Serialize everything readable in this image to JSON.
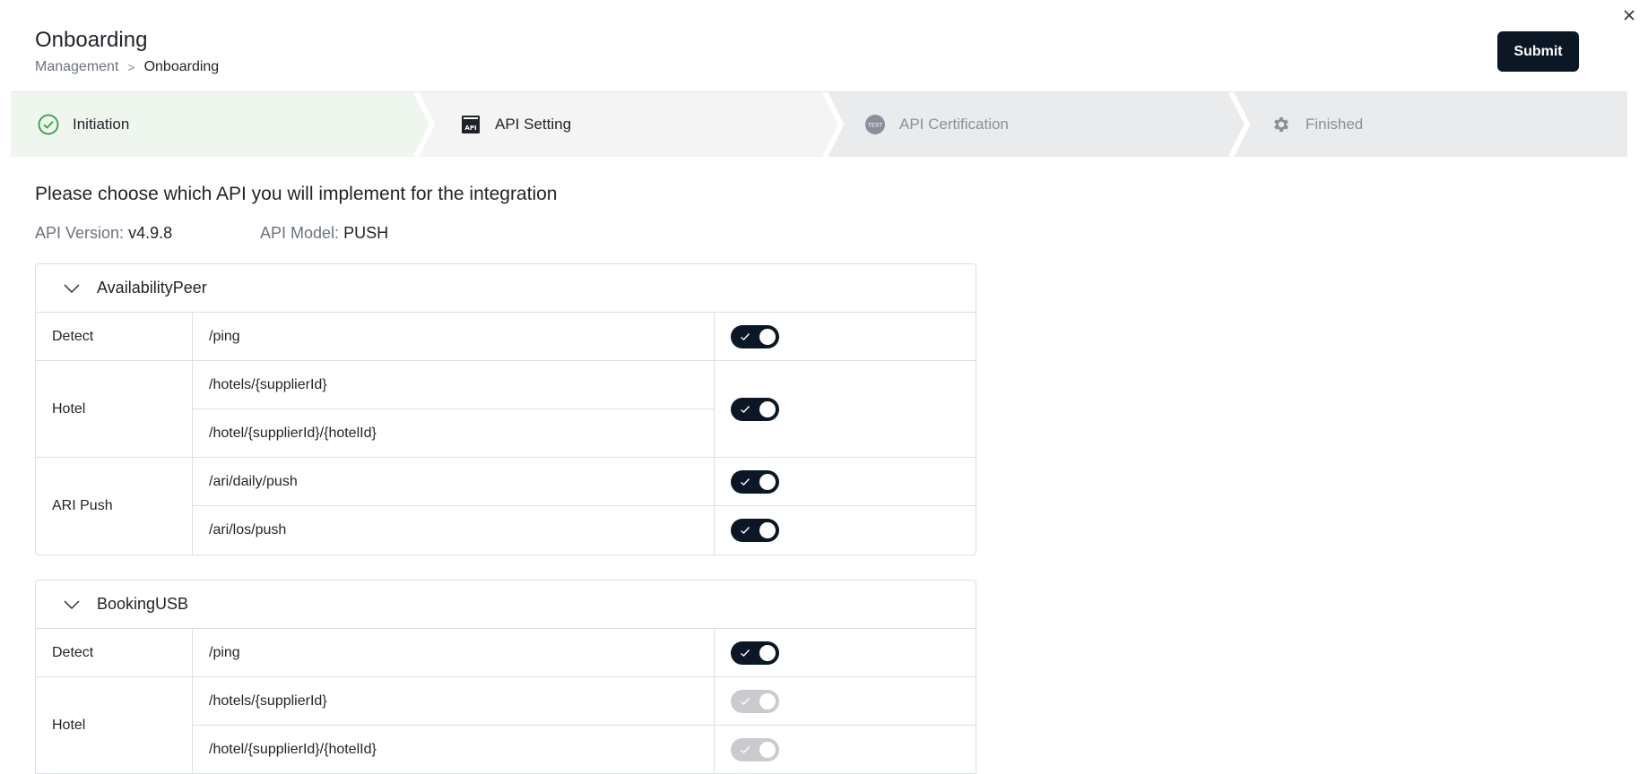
{
  "header": {
    "title": "Onboarding",
    "breadcrumb": {
      "parent": "Management",
      "separator": ">",
      "current": "Onboarding"
    },
    "submit_label": "Submit"
  },
  "steps": [
    {
      "label": "Initiation",
      "state": "done",
      "icon": "check-circle-icon"
    },
    {
      "label": "API Setting",
      "state": "active",
      "icon": "api-icon"
    },
    {
      "label": "API Certification",
      "state": "pending",
      "icon": "test-icon"
    },
    {
      "label": "Finished",
      "state": "pending",
      "icon": "gear-icon"
    }
  ],
  "question": "Please choose which API you will implement for the integration",
  "api_version": {
    "label": "API Version:",
    "value": "v4.9.8"
  },
  "api_model": {
    "label": "API Model:",
    "value": "PUSH"
  },
  "colors": {
    "accent": "#0b1724",
    "done": "#2ea043",
    "done_bg": "#eef6ee",
    "disabled_toggle": "#c9cbcf"
  },
  "groups": [
    {
      "name": "AvailabilityPeer",
      "rows": [
        {
          "category": "Detect",
          "endpoints": [
            "/ping"
          ],
          "toggles": [
            true
          ]
        },
        {
          "category": "Hotel",
          "endpoints": [
            "/hotels/{supplierId}",
            "/hotel/{supplierId}/{hotelId}"
          ],
          "toggles": [
            true
          ]
        },
        {
          "category": "ARI Push",
          "endpoints": [
            "/ari/daily/push",
            "/ari/los/push"
          ],
          "toggles": [
            true,
            true
          ]
        }
      ]
    },
    {
      "name": "BookingUSB",
      "rows": [
        {
          "category": "Detect",
          "endpoints": [
            "/ping"
          ],
          "toggles": [
            true
          ]
        },
        {
          "category": "Hotel",
          "endpoints": [
            "/hotels/{supplierId}",
            "/hotel/{supplierId}/{hotelId}"
          ],
          "toggles": [
            "disabled",
            "disabled"
          ]
        }
      ]
    }
  ]
}
